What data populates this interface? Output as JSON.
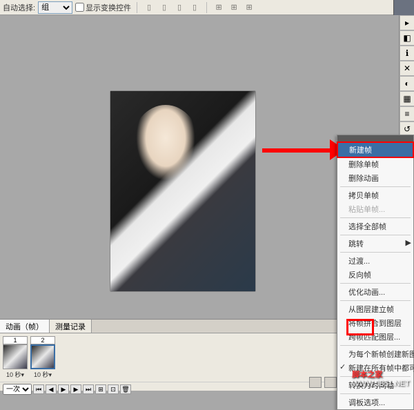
{
  "toolbar": {
    "label": "自动选择:",
    "select_value": "组",
    "checkbox_label": "显示变换控件"
  },
  "flyout": {
    "items": [
      {
        "label": "新建帧",
        "selected": true
      },
      {
        "label": "删除单帧"
      },
      {
        "label": "删除动画"
      },
      {
        "divider": true
      },
      {
        "label": "拷贝单帧"
      },
      {
        "label": "粘贴单帧...",
        "disabled": true
      },
      {
        "divider": true
      },
      {
        "label": "选择全部帧"
      },
      {
        "divider": true
      },
      {
        "label": "跳转",
        "arrow": true
      },
      {
        "divider": true
      },
      {
        "label": "过渡..."
      },
      {
        "label": "反向帧"
      },
      {
        "divider": true
      },
      {
        "label": "优化动画..."
      },
      {
        "divider": true
      },
      {
        "label": "从图层建立帧"
      },
      {
        "label": "将帧拼合到图层"
      },
      {
        "label": "跨帧匹配图层..."
      },
      {
        "divider": true
      },
      {
        "label": "为每个新帧创建新图层"
      },
      {
        "label": "新建在所有帧中都可见...",
        "checked": true
      },
      {
        "divider": true
      },
      {
        "label": "转换为时间轴"
      },
      {
        "divider": true
      },
      {
        "label": "调板选项..."
      }
    ]
  },
  "panel": {
    "tab1": "动画（帧）",
    "tab2": "测量记录",
    "frames": [
      {
        "num": "1",
        "time": "10 秒"
      },
      {
        "num": "2",
        "time": "10 秒"
      }
    ],
    "loop": "一次"
  },
  "watermark": {
    "site": "脚本之家",
    "url": "WWW.JB51.NET"
  }
}
